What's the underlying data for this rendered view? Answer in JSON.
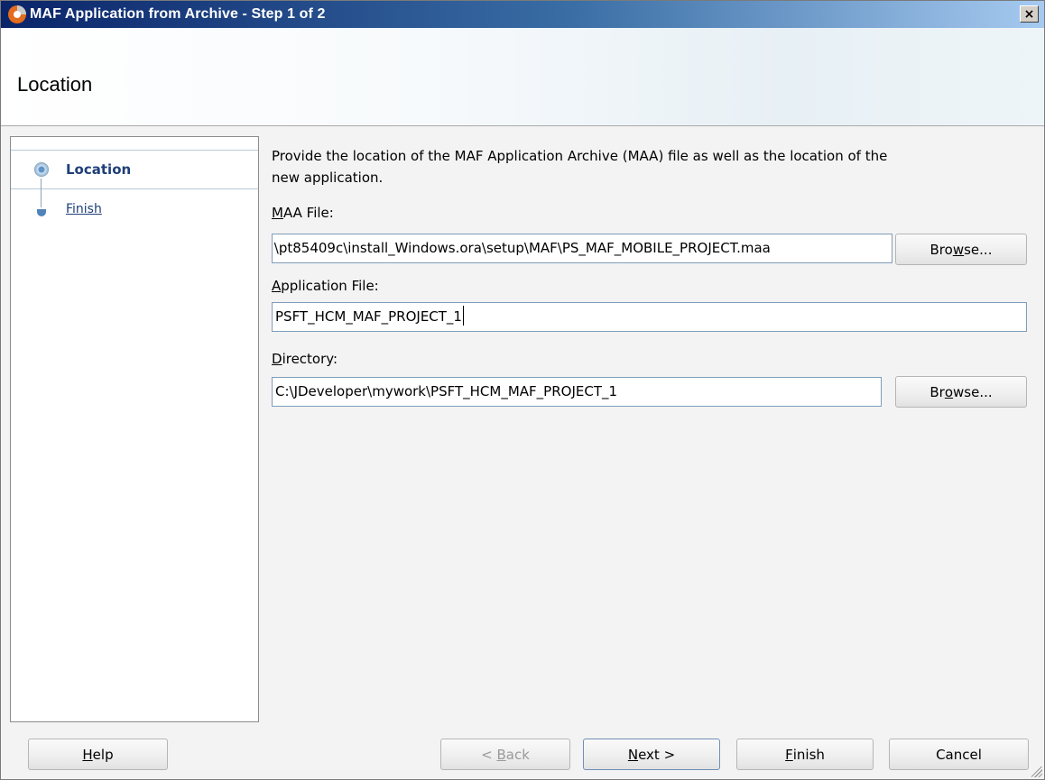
{
  "window": {
    "title": "MAF Application from Archive - Step 1 of 2",
    "close_label": "×"
  },
  "header": {
    "title": "Location"
  },
  "nav": {
    "items": [
      {
        "label": "Location",
        "state": "selected"
      },
      {
        "label": "Finish",
        "state": "link"
      }
    ]
  },
  "content": {
    "description": "Provide the location of the MAF Application Archive (MAA) file as well as the location of the new application.",
    "maa_file": {
      "label_mnemonic": "M",
      "label_rest": "AA File:",
      "value": "\\pt85409c\\install_Windows.ora\\setup\\MAF\\PS_MAF_MOBILE_PROJECT.maa",
      "value_prefix": "├",
      "browse_pre": "Bro",
      "browse_mnemonic": "w",
      "browse_post": "se..."
    },
    "application_file": {
      "label_mnemonic": "A",
      "label_rest": "pplication File:",
      "value": "PSFT_HCM_MAF_PROJECT_1"
    },
    "directory": {
      "label_mnemonic": "D",
      "label_rest": "irectory:",
      "value": "C:\\JDeveloper\\mywork\\PSFT_HCM_MAF_PROJECT_1",
      "browse_pre": "Br",
      "browse_mnemonic": "o",
      "browse_post": "wse..."
    }
  },
  "footer": {
    "help_mnemonic": "H",
    "help_rest": "elp",
    "back_pre": "< ",
    "back_mnemonic": "B",
    "back_rest": "ack",
    "next_mnemonic": "N",
    "next_rest": "ext >",
    "finish_mnemonic": "F",
    "finish_rest": "inish",
    "cancel_label": "Cancel"
  },
  "colors": {
    "title_bar_start": "#0a246a",
    "nav_text": "#1f3f78",
    "field_border": "#7f9db9"
  }
}
